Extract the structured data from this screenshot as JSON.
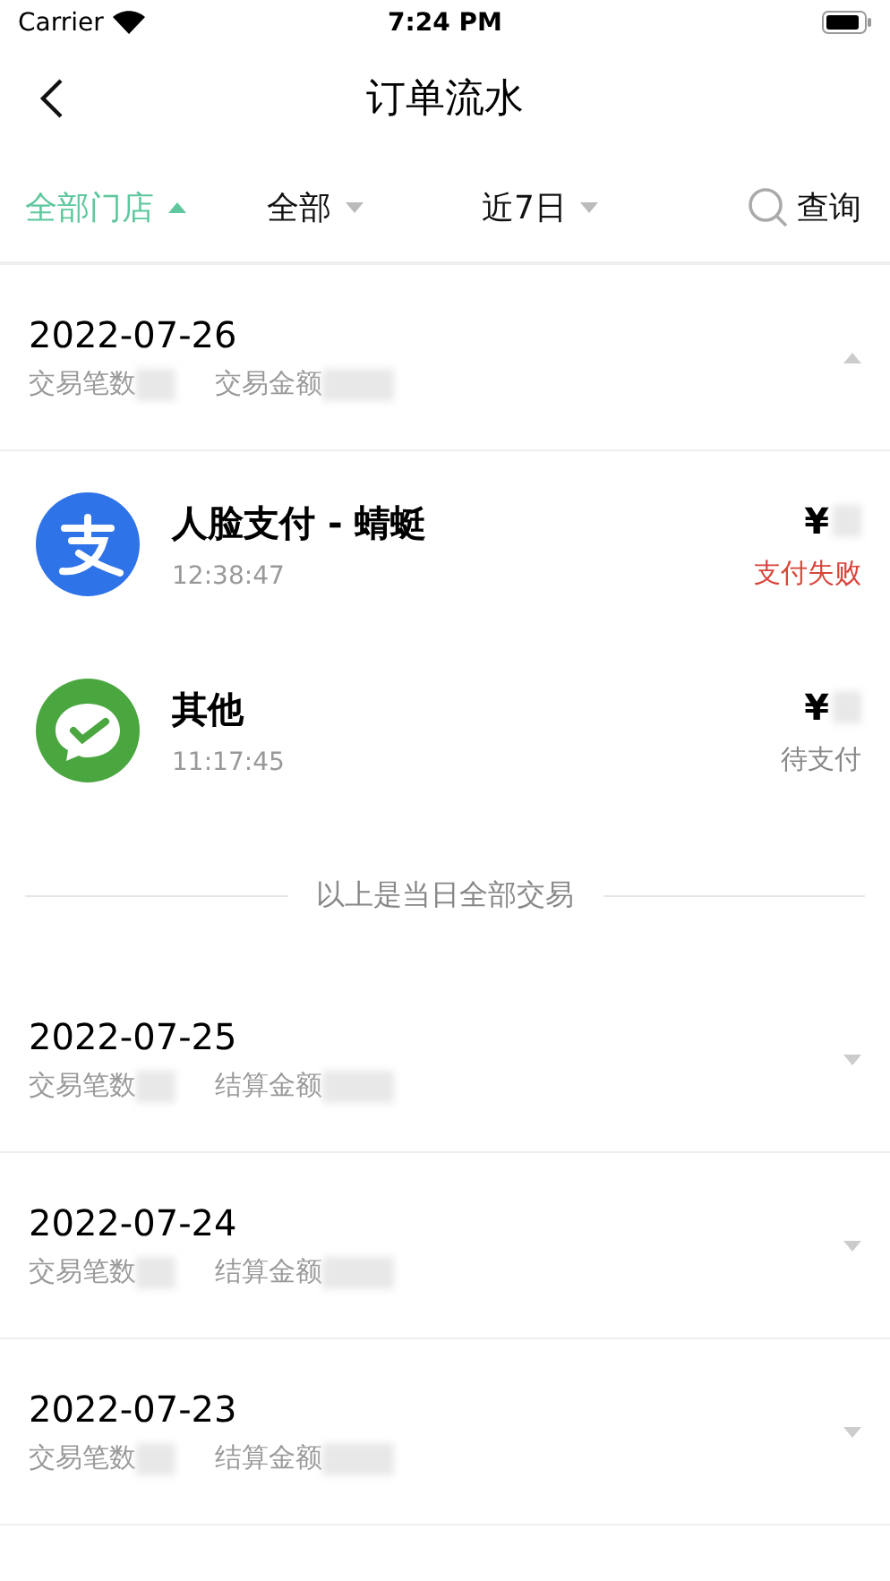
{
  "status_bar": {
    "carrier": "Carrier",
    "time": "7:24 PM"
  },
  "nav": {
    "title": "订单流水"
  },
  "filters": [
    {
      "label": "全部门店",
      "selected": true
    },
    {
      "label": "全部",
      "selected": false
    },
    {
      "label": "近7日",
      "selected": false
    }
  ],
  "search_button": "查询",
  "days": [
    {
      "date": "2022-07-26",
      "count_label": "交易笔数",
      "amount_label": "交易金额",
      "expanded": true,
      "transactions": [
        {
          "kind": "alipay",
          "title": "人脸支付 - 蜻蜓",
          "time": "12:38:47",
          "currency": "¥",
          "status": {
            "text": "支付失败",
            "color": "#d9443a"
          }
        },
        {
          "kind": "wechat",
          "title": "其他",
          "time": "11:17:45",
          "currency": "¥",
          "status": {
            "text": "待支付",
            "color": "#888888"
          }
        }
      ],
      "footer": "以上是当日全部交易"
    },
    {
      "date": "2022-07-25",
      "count_label": "交易笔数",
      "amount_label": "结算金额",
      "expanded": false
    },
    {
      "date": "2022-07-24",
      "count_label": "交易笔数",
      "amount_label": "结算金额",
      "expanded": false
    },
    {
      "date": "2022-07-23",
      "count_label": "交易笔数",
      "amount_label": "结算金额",
      "expanded": false
    }
  ]
}
